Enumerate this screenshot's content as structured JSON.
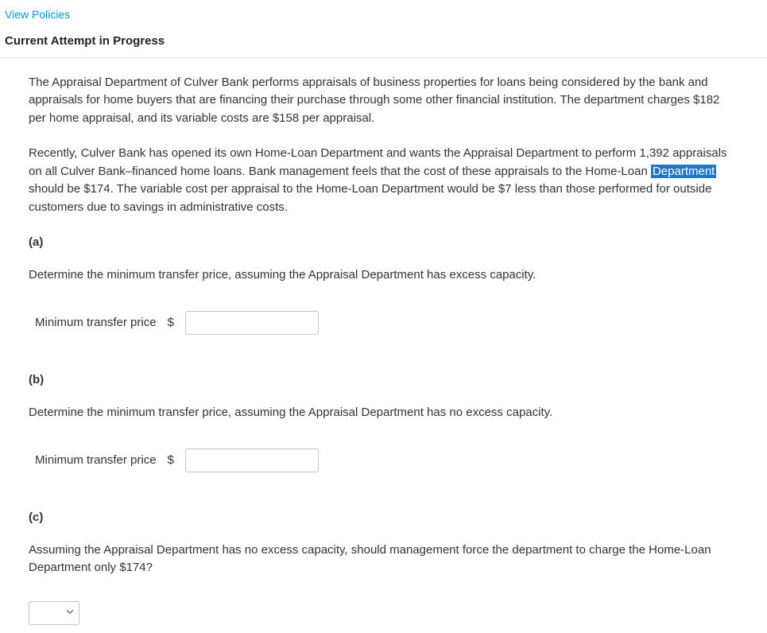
{
  "header": {
    "policies_link": "View Policies",
    "section_title": "Current Attempt in Progress"
  },
  "content": {
    "para1": "The Appraisal Department of Culver Bank performs appraisals of business properties for loans being considered by the bank and appraisals for home buyers that are financing their purchase through some other financial institution. The department charges $182 per home appraisal, and its variable costs are $158 per appraisal.",
    "para2_before": "Recently, Culver Bank has opened its own Home-Loan Department and wants the Appraisal Department to perform 1,392 appraisals on all Culver Bank–financed home loans. Bank management feels that the cost of these appraisals to the Home-Loan ",
    "para2_highlight": "Department",
    "para2_after": " should be $174. The variable cost per appraisal to the Home-Loan Department would be $7 less than those performed for outside customers due to savings in administrative costs.",
    "parts": {
      "a": {
        "label": "(a)",
        "prompt": "Determine the minimum transfer price, assuming the Appraisal Department has excess capacity.",
        "field_label": "Minimum transfer price",
        "currency": "$",
        "value": ""
      },
      "b": {
        "label": "(b)",
        "prompt": "Determine the minimum transfer price, assuming the Appraisal Department has no excess capacity.",
        "field_label": "Minimum transfer price",
        "currency": "$",
        "value": ""
      },
      "c": {
        "label": "(c)",
        "prompt": "Assuming the Appraisal Department has no excess capacity, should management force the department to charge the Home-Loan Department only $174?",
        "selected": ""
      }
    }
  }
}
